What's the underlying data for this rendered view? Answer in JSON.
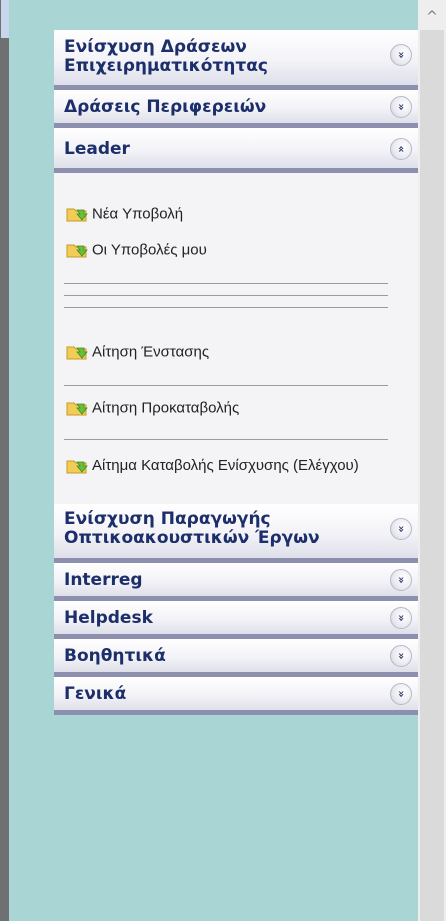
{
  "sections": [
    {
      "title": "Ενίσχυση Δράσεων Επιχειρηματικότητας",
      "toggle": "»",
      "expanded": false
    },
    {
      "title": "Δράσεις Περιφερειών",
      "toggle": "»",
      "expanded": false
    },
    {
      "title": "Leader",
      "toggle": "«",
      "expanded": true
    },
    {
      "title": "Ενίσχυση Παραγωγής Οπτικοακουστικών Έργων",
      "toggle": "»",
      "expanded": false
    },
    {
      "title": "Interreg",
      "toggle": "»",
      "expanded": false
    },
    {
      "title": "Helpdesk",
      "toggle": "»",
      "expanded": false
    },
    {
      "title": "Βοηθητικά",
      "toggle": "»",
      "expanded": false
    },
    {
      "title": "Γενικά",
      "toggle": "»",
      "expanded": false
    }
  ],
  "leader_items": [
    {
      "label": "Νέα Υποβολή",
      "icon": "folder-arrow-icon"
    },
    {
      "label": "Οι Υποβολές μου",
      "icon": "folder-arrow-icon"
    },
    {
      "label": "Αίτηση Ένστασης",
      "icon": "folder-arrow-icon"
    },
    {
      "label": "Αίτηση Προκαταβολής",
      "icon": "folder-arrow-icon"
    },
    {
      "label": "Αίτημα Καταβολής Ενίσχυσης (Ελέγχου)",
      "icon": "folder-arrow-icon"
    }
  ],
  "scrollbar": {
    "up_arrow": "^"
  },
  "colors": {
    "header_text": "#1c2f6b",
    "header_border": "#8d8fae",
    "background": "#a9d6d5"
  }
}
